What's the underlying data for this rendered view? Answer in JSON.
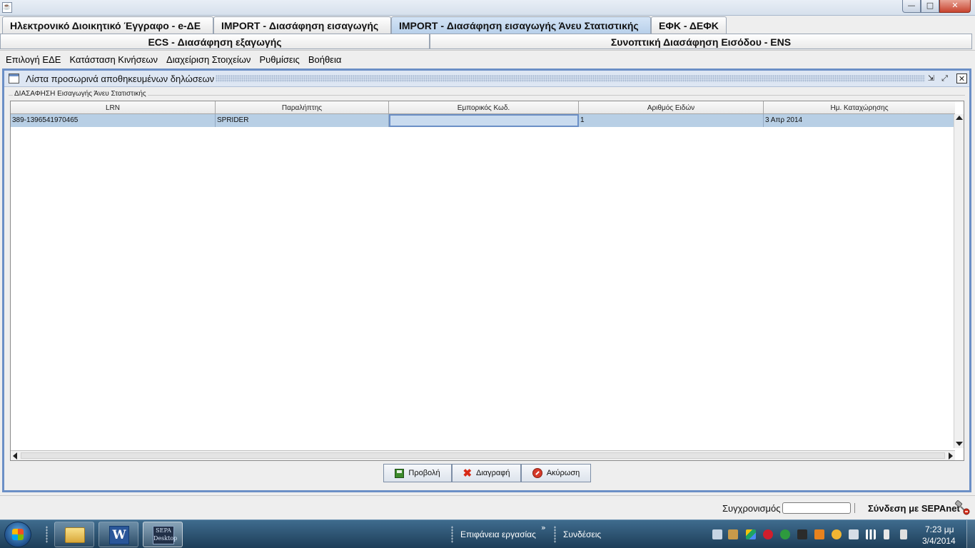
{
  "window": {
    "app_icon_glyph": "☕",
    "controls": {
      "minimize": "—",
      "maximize": "□",
      "close": "✕"
    }
  },
  "tabs_row1": [
    {
      "label": "Ηλεκτρονικό Διοικητικό Έγγραφο - e-ΔΕ",
      "active": false
    },
    {
      "label": "IMPORT - Διασάφηση εισαγωγής",
      "active": false
    },
    {
      "label": "IMPORT - Διασάφηση εισαγωγής Άνευ Στατιστικής",
      "active": true
    },
    {
      "label": "ΕΦΚ - ΔΕΦΚ",
      "active": false
    }
  ],
  "tabs_row2": [
    {
      "label": "ECS - Διασάφηση εξαγωγής"
    },
    {
      "label": "Συνοπτική Διασάφηση Εισόδου - ENS"
    }
  ],
  "menu": [
    "Επιλογή ΕΔΕ",
    "Κατάσταση Κινήσεων",
    "Διαχείριση Στοιχείων",
    "Ρυθμίσεις",
    "Βοήθεια"
  ],
  "frame": {
    "title": "Λίστα προσωρινά αποθηκευμένων δηλώσεων",
    "group_label": "ΔΙΑΣΑΦΗΣΗ Εισαγωγής Άνευ Στατιστικής",
    "btn_iconify": "⇲",
    "btn_maximize": "⤢",
    "btn_close": "✕"
  },
  "table": {
    "columns": [
      "LRN",
      "Παραλήπτης",
      "Εμπορικός Κωδ.",
      "Αριθμός Ειδών",
      "Ημ. Καταχώρησης"
    ],
    "rows": [
      [
        "389-1396541970465",
        "SPRIDER",
        "",
        "1",
        "3 Απρ 2014"
      ]
    ]
  },
  "buttons": {
    "view": "Προβολή",
    "delete": "Διαγραφή",
    "cancel": "Ακύρωση"
  },
  "statusbar": {
    "sync_label": "Συγχρονισμός",
    "sync_progress": 0,
    "sepanet_label": "Σύνδεση με SEPAnet"
  },
  "taskbar": {
    "word_letter": "W",
    "sepa_app_text": "SEPA Desktop",
    "desktop_toolbar": "Επιφάνεια εργασίας",
    "chevron": "»",
    "connections_toolbar": "Συνδέσεις",
    "clock_time": "7:23 μμ",
    "clock_date": "3/4/2014"
  },
  "colors": {
    "frame_border": "#6b8fc6",
    "selected_row": "#b8cfe5",
    "active_tab": "#b8d0ea",
    "taskbar": "#1d3d58"
  }
}
